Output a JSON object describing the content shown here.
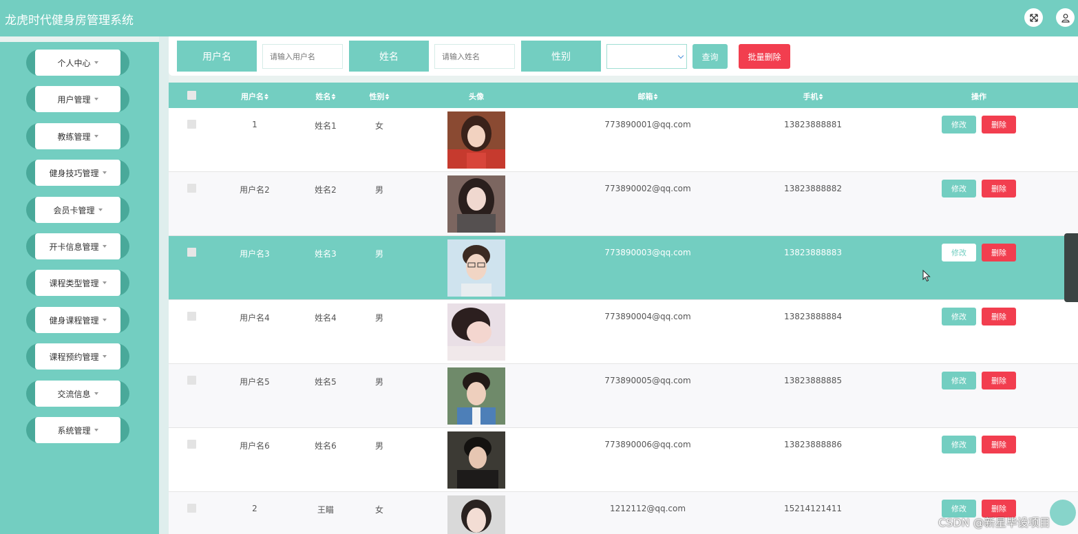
{
  "header": {
    "title": "龙虎时代健身房管理系统",
    "icons": [
      "fullscreen-icon",
      "user-icon"
    ]
  },
  "sidebar": {
    "items": [
      {
        "label": "个人中心"
      },
      {
        "label": "用户管理"
      },
      {
        "label": "教练管理"
      },
      {
        "label": "健身技巧管理"
      },
      {
        "label": "会员卡管理"
      },
      {
        "label": "开卡信息管理"
      },
      {
        "label": "课程类型管理"
      },
      {
        "label": "健身课程管理"
      },
      {
        "label": "课程预约管理"
      },
      {
        "label": "交流信息"
      },
      {
        "label": "系统管理"
      }
    ]
  },
  "search": {
    "username_label": "用户名",
    "username_placeholder": "请输入用户名",
    "name_label": "姓名",
    "name_placeholder": "请输入姓名",
    "gender_label": "性别",
    "gender_value": "",
    "query_button": "查询",
    "batch_delete_button": "批量删除"
  },
  "table": {
    "columns": {
      "username": "用户名",
      "name": "姓名",
      "gender": "性别",
      "avatar": "头像",
      "email": "邮箱",
      "phone": "手机",
      "actions": "操作"
    },
    "edit_label": "修改",
    "delete_label": "删除",
    "rows": [
      {
        "username": "1",
        "name": "姓名1",
        "gender": "女",
        "email": "773890001@qq.com",
        "phone": "13823888881"
      },
      {
        "username": "用户名2",
        "name": "姓名2",
        "gender": "男",
        "email": "773890002@qq.com",
        "phone": "13823888882"
      },
      {
        "username": "用户名3",
        "name": "姓名3",
        "gender": "男",
        "email": "773890003@qq.com",
        "phone": "13823888883"
      },
      {
        "username": "用户名4",
        "name": "姓名4",
        "gender": "男",
        "email": "773890004@qq.com",
        "phone": "13823888884"
      },
      {
        "username": "用户名5",
        "name": "姓名5",
        "gender": "男",
        "email": "773890005@qq.com",
        "phone": "13823888885"
      },
      {
        "username": "用户名6",
        "name": "姓名6",
        "gender": "男",
        "email": "773890006@qq.com",
        "phone": "13823888886"
      },
      {
        "username": "2",
        "name": "王瞄",
        "gender": "女",
        "email": "1212112@qq.com",
        "phone": "15214121411"
      }
    ]
  },
  "watermark": "CSDN @新星毕设项目",
  "colors": {
    "accent": "#73cec1",
    "danger": "#f23e4f"
  }
}
